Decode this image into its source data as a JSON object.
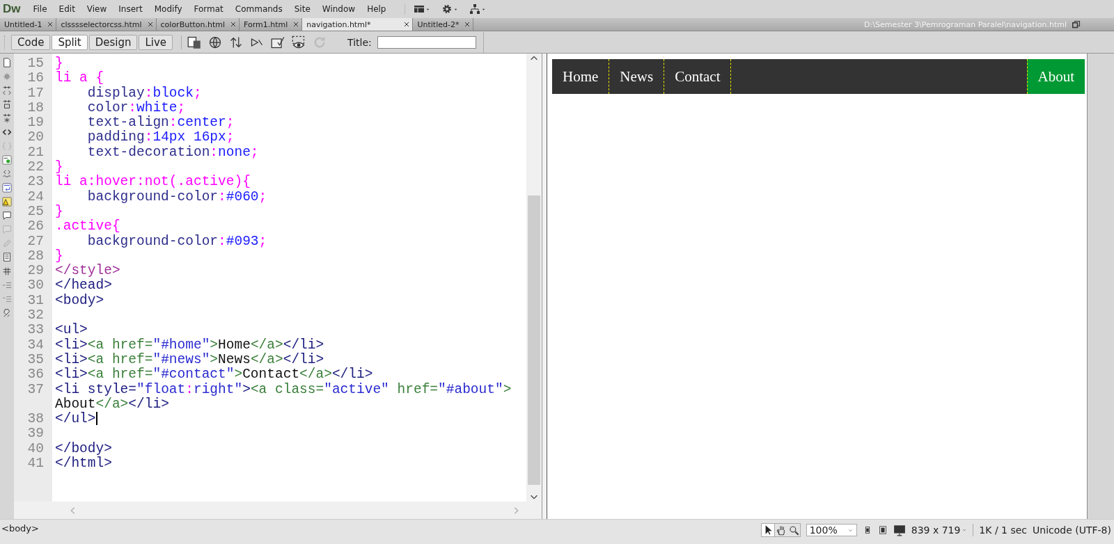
{
  "app": {
    "logo": "Dw"
  },
  "menu": [
    "File",
    "Edit",
    "View",
    "Insert",
    "Modify",
    "Format",
    "Commands",
    "Site",
    "Window",
    "Help"
  ],
  "document_tabs": [
    {
      "label": "Untitled-1",
      "selected": false
    },
    {
      "label": "clsssselectorcss.html",
      "selected": false
    },
    {
      "label": "colorButton.html",
      "selected": false
    },
    {
      "label": "Form1.html",
      "selected": false
    },
    {
      "label": "navigation.html*",
      "selected": true
    },
    {
      "label": "Untitled-2*",
      "selected": false
    }
  ],
  "file_path": "D:\\Semester 3\\Pemrograman Paralel\\navigation.html",
  "view_buttons": [
    {
      "label": "Code",
      "selected": false
    },
    {
      "label": "Split",
      "selected": true
    },
    {
      "label": "Design",
      "selected": false
    },
    {
      "label": "Live",
      "selected": false
    }
  ],
  "title_field": {
    "label": "Title:"
  },
  "code": {
    "lines": [
      {
        "number": "15",
        "tokens": [
          {
            "kind": "punct",
            "text": "}"
          }
        ]
      },
      {
        "number": "16",
        "tokens": [
          {
            "kind": "punct",
            "text": "li a {"
          }
        ]
      },
      {
        "number": "17",
        "tokens": [
          {
            "kind": "prop",
            "text": "    display"
          },
          {
            "kind": "punct",
            "text": ":"
          },
          {
            "kind": "value",
            "text": "block"
          },
          {
            "kind": "punct",
            "text": ";"
          }
        ]
      },
      {
        "number": "18",
        "tokens": [
          {
            "kind": "prop",
            "text": "    color"
          },
          {
            "kind": "punct",
            "text": ":"
          },
          {
            "kind": "value",
            "text": "white"
          },
          {
            "kind": "punct",
            "text": ";"
          }
        ]
      },
      {
        "number": "19",
        "tokens": [
          {
            "kind": "prop",
            "text": "    text-align"
          },
          {
            "kind": "punct",
            "text": ":"
          },
          {
            "kind": "value",
            "text": "center"
          },
          {
            "kind": "punct",
            "text": ";"
          }
        ]
      },
      {
        "number": "20",
        "tokens": [
          {
            "kind": "prop",
            "text": "    padding"
          },
          {
            "kind": "punct",
            "text": ":"
          },
          {
            "kind": "value",
            "text": "14px 16px"
          },
          {
            "kind": "punct",
            "text": ";"
          }
        ]
      },
      {
        "number": "21",
        "tokens": [
          {
            "kind": "prop",
            "text": "    text-decoration"
          },
          {
            "kind": "punct",
            "text": ":"
          },
          {
            "kind": "value",
            "text": "none"
          },
          {
            "kind": "punct",
            "text": ";"
          }
        ]
      },
      {
        "number": "22",
        "tokens": [
          {
            "kind": "punct",
            "text": "}"
          }
        ]
      },
      {
        "number": "23",
        "tokens": [
          {
            "kind": "punct",
            "text": "li a:hover:not(.active){"
          }
        ]
      },
      {
        "number": "24",
        "tokens": [
          {
            "kind": "prop",
            "text": "    background-color"
          },
          {
            "kind": "punct",
            "text": ":"
          },
          {
            "kind": "value",
            "text": "#060"
          },
          {
            "kind": "punct",
            "text": ";"
          }
        ]
      },
      {
        "number": "25",
        "tokens": [
          {
            "kind": "punct",
            "text": "}"
          }
        ]
      },
      {
        "number": "26",
        "tokens": [
          {
            "kind": "punct",
            "text": ".active{"
          }
        ]
      },
      {
        "number": "27",
        "tokens": [
          {
            "kind": "prop",
            "text": "    background-color"
          },
          {
            "kind": "punct",
            "text": ":"
          },
          {
            "kind": "value",
            "text": "#093"
          },
          {
            "kind": "punct",
            "text": ";"
          }
        ]
      },
      {
        "number": "28",
        "tokens": [
          {
            "kind": "punct",
            "text": "}"
          }
        ]
      },
      {
        "number": "29",
        "tokens": [
          {
            "kind": "styletag",
            "text": "</style>"
          }
        ]
      },
      {
        "number": "30",
        "tokens": [
          {
            "kind": "tag",
            "text": "</head>"
          }
        ]
      },
      {
        "number": "31",
        "tokens": [
          {
            "kind": "tag",
            "text": "<body>"
          }
        ]
      },
      {
        "number": "32"
      },
      {
        "number": "33",
        "tokens": [
          {
            "kind": "tag",
            "text": "<ul>"
          }
        ]
      },
      {
        "number": "34",
        "tokens": [
          {
            "kind": "tag",
            "text": "<li>"
          },
          {
            "kind": "atag",
            "text": "<a href="
          },
          {
            "kind": "string",
            "text": "\"#home\""
          },
          {
            "kind": "atag",
            "text": ">"
          },
          {
            "kind": "text",
            "text": "Home"
          },
          {
            "kind": "atag",
            "text": "</a>"
          },
          {
            "kind": "tag",
            "text": "</li>"
          }
        ]
      },
      {
        "number": "35",
        "tokens": [
          {
            "kind": "tag",
            "text": "<li>"
          },
          {
            "kind": "atag",
            "text": "<a href="
          },
          {
            "kind": "string",
            "text": "\"#news\""
          },
          {
            "kind": "atag",
            "text": ">"
          },
          {
            "kind": "text",
            "text": "News"
          },
          {
            "kind": "atag",
            "text": "</a>"
          },
          {
            "kind": "tag",
            "text": "</li>"
          }
        ]
      },
      {
        "number": "36",
        "tokens": [
          {
            "kind": "tag",
            "text": "<li>"
          },
          {
            "kind": "atag",
            "text": "<a href="
          },
          {
            "kind": "string",
            "text": "\"#contact\""
          },
          {
            "kind": "atag",
            "text": ">"
          },
          {
            "kind": "text",
            "text": "Contact"
          },
          {
            "kind": "atag",
            "text": "</a>"
          },
          {
            "kind": "tag",
            "text": "</li>"
          }
        ]
      },
      {
        "number": "37",
        "tokens": [
          {
            "kind": "tag",
            "text": "<li style="
          },
          {
            "kind": "string",
            "text": "\"float"
          },
          {
            "kind": "punct",
            "text": ":"
          },
          {
            "kind": "string",
            "text": "right\""
          },
          {
            "kind": "tag",
            "text": ">"
          },
          {
            "kind": "atag",
            "text": "<a class="
          },
          {
            "kind": "string",
            "text": "\"active\""
          },
          {
            "kind": "atag",
            "text": " href="
          },
          {
            "kind": "string",
            "text": "\"#about\""
          },
          {
            "kind": "atag",
            "text": ">"
          }
        ]
      },
      {
        "tokens": [
          {
            "kind": "text",
            "text": "About"
          },
          {
            "kind": "atag",
            "text": "</a>"
          },
          {
            "kind": "tag",
            "text": "</li>"
          }
        ]
      },
      {
        "number": "38",
        "tokens": [
          {
            "kind": "tag",
            "text": "</ul>"
          }
        ],
        "cursor": true
      },
      {
        "number": "39"
      },
      {
        "number": "40",
        "tokens": [
          {
            "kind": "tag",
            "text": "</body>"
          }
        ]
      },
      {
        "number": "41",
        "tokens": [
          {
            "kind": "tag",
            "text": "</html>"
          }
        ]
      }
    ]
  },
  "preview": {
    "nav_items_left": [
      {
        "label": "Home",
        "active": false
      },
      {
        "label": "News",
        "active": false
      },
      {
        "label": "Contact",
        "active": false
      }
    ],
    "nav_items_right": [
      {
        "label": "About",
        "active": true
      }
    ]
  },
  "status_bar": {
    "tag": "<body>",
    "zoom": "100%",
    "size": "839 x 719",
    "download": "1K / 1 sec",
    "encoding": "Unicode (UTF-8)"
  }
}
